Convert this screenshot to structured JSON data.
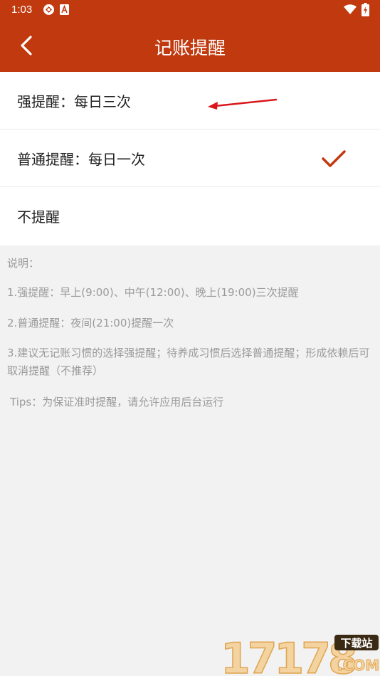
{
  "status_bar": {
    "time": "1:03",
    "icons": [
      "app-notification-icon",
      "a-letter-notification-icon",
      "wifi-icon",
      "battery-charging-icon"
    ]
  },
  "app_bar": {
    "title": "记账提醒",
    "back_icon": "back-chevron-icon"
  },
  "options": [
    {
      "label": "强提醒：每日三次",
      "selected": false
    },
    {
      "label": "普通提醒：每日一次",
      "selected": true
    },
    {
      "label": "不提醒",
      "selected": false
    }
  ],
  "notes": {
    "heading": "说明：",
    "items": [
      "1.强提醒：早上(9:00)、中午(12:00)、晚上(19:00)三次提醒",
      "2.普通提醒：夜间(21:00)提醒一次",
      "3.建议无记账习惯的选择强提醒；待养成习惯后选择普通提醒；形成依赖后可取消提醒（不推荐）"
    ],
    "tips": "Tips：为保证准时提醒，请允许应用后台运行"
  },
  "watermark": {
    "number": "17178",
    "tag": "下载站",
    "suffix": ".COM"
  },
  "colors": {
    "primary": "#c1390e",
    "page_background": "#f2f2f2",
    "note_text": "#9a9a9a",
    "annotation_arrow": "#d9161b"
  }
}
